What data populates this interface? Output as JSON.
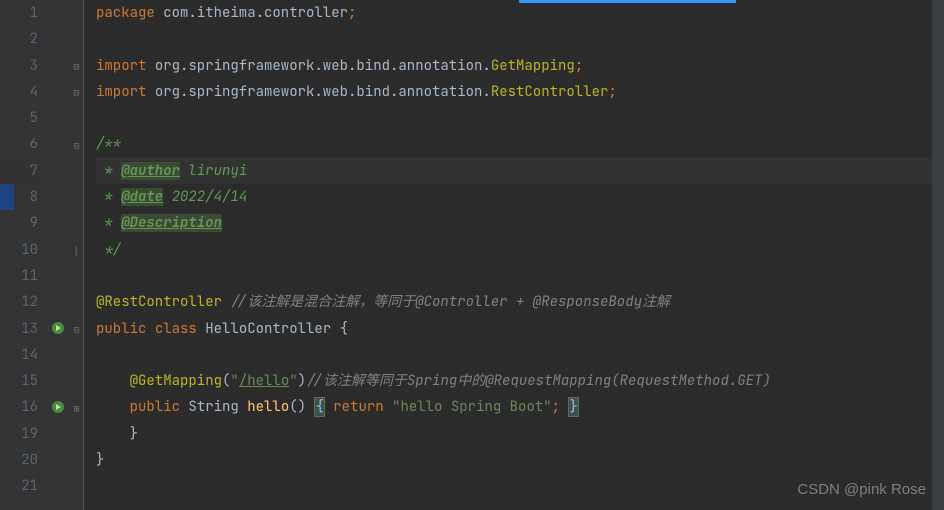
{
  "gutter": {
    "line_numbers": [
      "1",
      "2",
      "3",
      "4",
      "5",
      "6",
      "7",
      "8",
      "9",
      "10",
      "11",
      "12",
      "13",
      "14",
      "15",
      "16",
      "19",
      "20",
      "21"
    ],
    "current_line": "7"
  },
  "code": {
    "l1": {
      "kw": "package ",
      "pkg": "com.itheima.controller",
      "semi": ";"
    },
    "l3": {
      "kw": "import ",
      "pkg": "org.springframework.web.bind.annotation.",
      "cls": "GetMapping",
      "semi": ";"
    },
    "l4": {
      "kw": "import ",
      "pkg": "org.springframework.web.bind.annotation.",
      "cls": "RestController",
      "semi": ";"
    },
    "l6": {
      "doc": "/**"
    },
    "l7": {
      "prefix": " * ",
      "tag": "@author",
      "val": " lirunyi"
    },
    "l8": {
      "prefix": " * ",
      "tag": "@date",
      "val": " 2022/4/14"
    },
    "l9": {
      "prefix": " * ",
      "tag": "@Description"
    },
    "l10": {
      "doc": " */"
    },
    "l12": {
      "ann": "@RestController",
      "cmt": " //该注解是混合注解，等同于@Controller + @ResponseBody注解"
    },
    "l13": {
      "kw1": "public ",
      "kw2": "class ",
      "cls": "HelloController ",
      "brace": "{"
    },
    "l15": {
      "indent": "    ",
      "ann": "@GetMapping",
      "paren1": "(",
      "str": "\"",
      "str_u": "/hello",
      "str2": "\"",
      "paren2": ")",
      "cmt": "//该注解等同于Spring中的@RequestMapping(RequestMethod.GET)"
    },
    "l16": {
      "indent": "    ",
      "kw1": "public ",
      "type": "String ",
      "method": "hello",
      "paren": "() ",
      "brace1": "{",
      "kw2": " return ",
      "str": "\"hello Spring Boot\"",
      "semi": "; ",
      "brace2": "}"
    },
    "l19": {
      "indent": "    ",
      "brace": "}"
    },
    "l20": {
      "brace": "}"
    }
  },
  "watermark": "CSDN @pink Rose"
}
